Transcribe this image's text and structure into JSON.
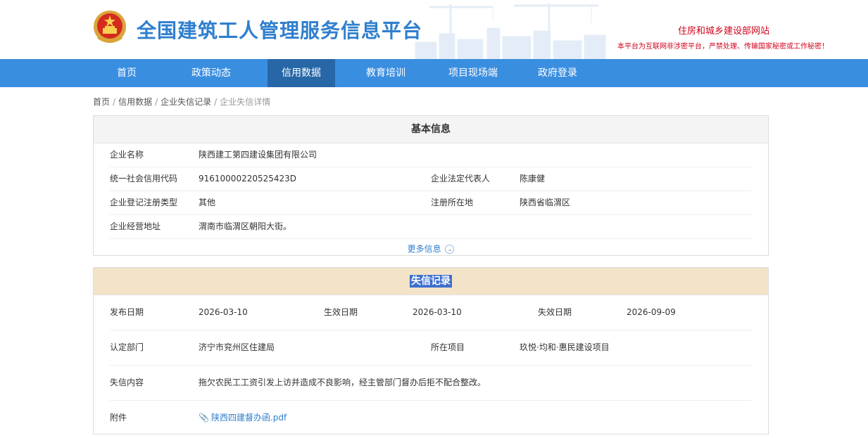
{
  "header": {
    "site_title": "全国建筑工人管理服务信息平台",
    "ministry_link": "住房和城乡建设部网站",
    "secret_notice": "本平台为互联网非涉密平台，严禁处理、传输国家秘密或工作秘密！"
  },
  "nav": {
    "items": [
      {
        "label": "首页"
      },
      {
        "label": "政策动态"
      },
      {
        "label": "信用数据"
      },
      {
        "label": "教育培训"
      },
      {
        "label": "项目现场端"
      },
      {
        "label": "政府登录"
      }
    ],
    "active": "信用数据"
  },
  "breadcrumb": [
    "首页",
    "信用数据",
    "企业失信记录",
    "企业失信详情"
  ],
  "basic_info": {
    "title": "基本信息",
    "company_name_label": "企业名称",
    "company_name": "陕西建工第四建设集团有限公司",
    "credit_code_label": "统一社会信用代码",
    "credit_code": "91610000220525423D",
    "legal_rep_label": "企业法定代表人",
    "legal_rep": "陈康健",
    "reg_type_label": "企业登记注册类型",
    "reg_type": "其他",
    "reg_location_label": "注册所在地",
    "reg_location": "陕西省临渭区",
    "address_label": "企业经营地址",
    "address": "渭南市临渭区朝阳大街。",
    "more_label": "更多信息"
  },
  "credit_record": {
    "title": "失信记录",
    "publish_date_label": "发布日期",
    "publish_date": "2026-03-10",
    "effective_date_label": "生效日期",
    "effective_date": "2026-03-10",
    "expiry_date_label": "失效日期",
    "expiry_date": "2026-09-09",
    "department_label": "认定部门",
    "department": "济宁市兖州区住建局",
    "project_label": "所在项目",
    "project": "玖悦·均和·惠民建设项目",
    "content_label": "失信内容",
    "content": "拖欠农民工工资引发上访并造成不良影响，经主管部门督办后拒不配合整改。",
    "attachment_label": "附件",
    "attachment": "陕西四建督办函.pdf"
  },
  "colors": {
    "brand_blue": "#2f7fce",
    "nav_bg": "#3a8ee0",
    "nav_active": "#2767a8",
    "notice_red": "#d0021b",
    "record_head_bg": "#f3e3c8"
  },
  "icons": {
    "emblem": "national-emblem-icon",
    "more": "chevron-down-icon",
    "attachment": "paperclip-icon"
  }
}
